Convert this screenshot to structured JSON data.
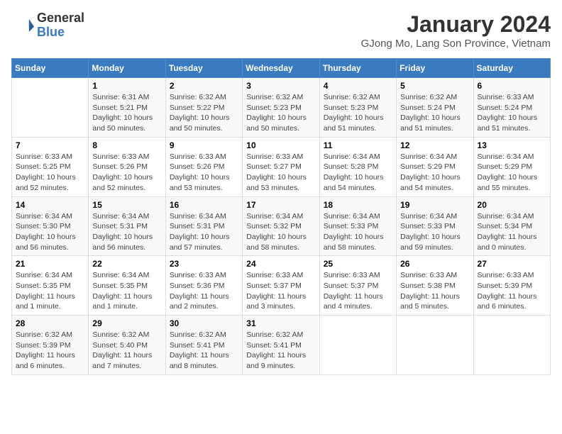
{
  "header": {
    "logo_general": "General",
    "logo_blue": "Blue",
    "month_year": "January 2024",
    "location": "GJong Mo, Lang Son Province, Vietnam"
  },
  "days_of_week": [
    "Sunday",
    "Monday",
    "Tuesday",
    "Wednesday",
    "Thursday",
    "Friday",
    "Saturday"
  ],
  "weeks": [
    [
      {
        "day": "",
        "info": ""
      },
      {
        "day": "1",
        "info": "Sunrise: 6:31 AM\nSunset: 5:21 PM\nDaylight: 10 hours\nand 50 minutes."
      },
      {
        "day": "2",
        "info": "Sunrise: 6:32 AM\nSunset: 5:22 PM\nDaylight: 10 hours\nand 50 minutes."
      },
      {
        "day": "3",
        "info": "Sunrise: 6:32 AM\nSunset: 5:23 PM\nDaylight: 10 hours\nand 50 minutes."
      },
      {
        "day": "4",
        "info": "Sunrise: 6:32 AM\nSunset: 5:23 PM\nDaylight: 10 hours\nand 51 minutes."
      },
      {
        "day": "5",
        "info": "Sunrise: 6:32 AM\nSunset: 5:24 PM\nDaylight: 10 hours\nand 51 minutes."
      },
      {
        "day": "6",
        "info": "Sunrise: 6:33 AM\nSunset: 5:24 PM\nDaylight: 10 hours\nand 51 minutes."
      }
    ],
    [
      {
        "day": "7",
        "info": "Sunrise: 6:33 AM\nSunset: 5:25 PM\nDaylight: 10 hours\nand 52 minutes."
      },
      {
        "day": "8",
        "info": "Sunrise: 6:33 AM\nSunset: 5:26 PM\nDaylight: 10 hours\nand 52 minutes."
      },
      {
        "day": "9",
        "info": "Sunrise: 6:33 AM\nSunset: 5:26 PM\nDaylight: 10 hours\nand 53 minutes."
      },
      {
        "day": "10",
        "info": "Sunrise: 6:33 AM\nSunset: 5:27 PM\nDaylight: 10 hours\nand 53 minutes."
      },
      {
        "day": "11",
        "info": "Sunrise: 6:34 AM\nSunset: 5:28 PM\nDaylight: 10 hours\nand 54 minutes."
      },
      {
        "day": "12",
        "info": "Sunrise: 6:34 AM\nSunset: 5:29 PM\nDaylight: 10 hours\nand 54 minutes."
      },
      {
        "day": "13",
        "info": "Sunrise: 6:34 AM\nSunset: 5:29 PM\nDaylight: 10 hours\nand 55 minutes."
      }
    ],
    [
      {
        "day": "14",
        "info": "Sunrise: 6:34 AM\nSunset: 5:30 PM\nDaylight: 10 hours\nand 56 minutes."
      },
      {
        "day": "15",
        "info": "Sunrise: 6:34 AM\nSunset: 5:31 PM\nDaylight: 10 hours\nand 56 minutes."
      },
      {
        "day": "16",
        "info": "Sunrise: 6:34 AM\nSunset: 5:31 PM\nDaylight: 10 hours\nand 57 minutes."
      },
      {
        "day": "17",
        "info": "Sunrise: 6:34 AM\nSunset: 5:32 PM\nDaylight: 10 hours\nand 58 minutes."
      },
      {
        "day": "18",
        "info": "Sunrise: 6:34 AM\nSunset: 5:33 PM\nDaylight: 10 hours\nand 58 minutes."
      },
      {
        "day": "19",
        "info": "Sunrise: 6:34 AM\nSunset: 5:33 PM\nDaylight: 10 hours\nand 59 minutes."
      },
      {
        "day": "20",
        "info": "Sunrise: 6:34 AM\nSunset: 5:34 PM\nDaylight: 11 hours\nand 0 minutes."
      }
    ],
    [
      {
        "day": "21",
        "info": "Sunrise: 6:34 AM\nSunset: 5:35 PM\nDaylight: 11 hours\nand 1 minute."
      },
      {
        "day": "22",
        "info": "Sunrise: 6:34 AM\nSunset: 5:35 PM\nDaylight: 11 hours\nand 1 minute."
      },
      {
        "day": "23",
        "info": "Sunrise: 6:33 AM\nSunset: 5:36 PM\nDaylight: 11 hours\nand 2 minutes."
      },
      {
        "day": "24",
        "info": "Sunrise: 6:33 AM\nSunset: 5:37 PM\nDaylight: 11 hours\nand 3 minutes."
      },
      {
        "day": "25",
        "info": "Sunrise: 6:33 AM\nSunset: 5:37 PM\nDaylight: 11 hours\nand 4 minutes."
      },
      {
        "day": "26",
        "info": "Sunrise: 6:33 AM\nSunset: 5:38 PM\nDaylight: 11 hours\nand 5 minutes."
      },
      {
        "day": "27",
        "info": "Sunrise: 6:33 AM\nSunset: 5:39 PM\nDaylight: 11 hours\nand 6 minutes."
      }
    ],
    [
      {
        "day": "28",
        "info": "Sunrise: 6:32 AM\nSunset: 5:39 PM\nDaylight: 11 hours\nand 6 minutes."
      },
      {
        "day": "29",
        "info": "Sunrise: 6:32 AM\nSunset: 5:40 PM\nDaylight: 11 hours\nand 7 minutes."
      },
      {
        "day": "30",
        "info": "Sunrise: 6:32 AM\nSunset: 5:41 PM\nDaylight: 11 hours\nand 8 minutes."
      },
      {
        "day": "31",
        "info": "Sunrise: 6:32 AM\nSunset: 5:41 PM\nDaylight: 11 hours\nand 9 minutes."
      },
      {
        "day": "",
        "info": ""
      },
      {
        "day": "",
        "info": ""
      },
      {
        "day": "",
        "info": ""
      }
    ]
  ]
}
